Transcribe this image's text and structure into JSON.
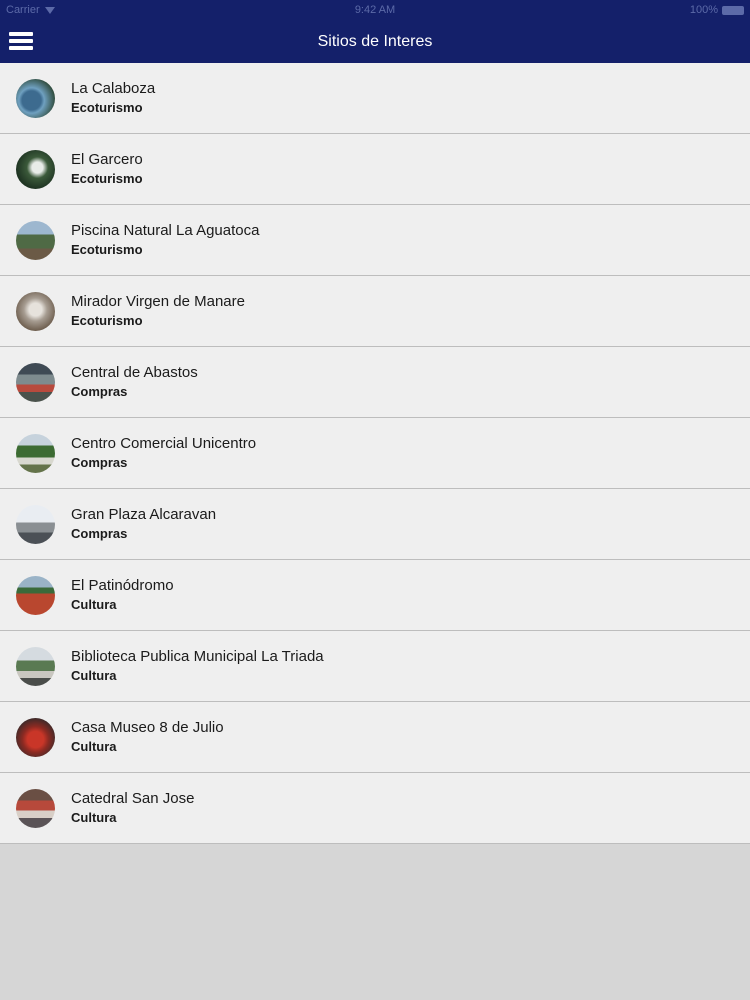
{
  "status_bar": {
    "carrier": "Carrier",
    "time": "9:42 AM",
    "battery": "100%"
  },
  "header": {
    "title": "Sitios de Interes"
  },
  "sites": [
    {
      "name": "La Calaboza",
      "category": "Ecoturismo"
    },
    {
      "name": "El Garcero",
      "category": "Ecoturismo"
    },
    {
      "name": "Piscina Natural La Aguatoca",
      "category": "Ecoturismo"
    },
    {
      "name": "Mirador Virgen de Manare",
      "category": "Ecoturismo"
    },
    {
      "name": "Central de Abastos",
      "category": "Compras"
    },
    {
      "name": "Centro Comercial Unicentro",
      "category": "Compras"
    },
    {
      "name": "Gran Plaza Alcaravan",
      "category": "Compras"
    },
    {
      "name": "El Patinódromo",
      "category": "Cultura"
    },
    {
      "name": "Biblioteca Publica Municipal La Triada",
      "category": "Cultura"
    },
    {
      "name": "Casa Museo 8 de Julio",
      "category": "Cultura"
    },
    {
      "name": "Catedral San Jose",
      "category": "Cultura"
    }
  ]
}
